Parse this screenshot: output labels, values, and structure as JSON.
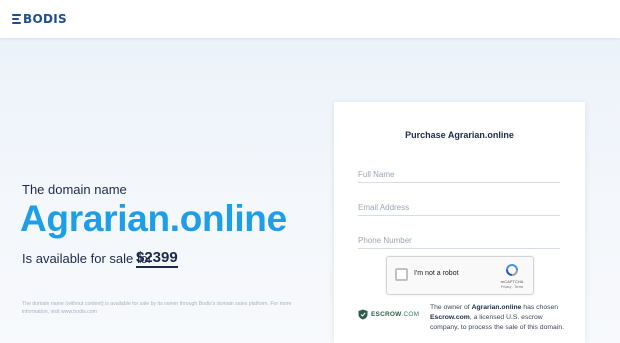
{
  "header": {
    "logo_text": "BODIS"
  },
  "hero": {
    "lead": "The domain name",
    "domain": "Agrarian.online",
    "sale_text": "Is available for sale for",
    "price": "$2399",
    "fineprint": "The domain name (without content) is available for sale by its owner through Bodis's domain sales platform. For more information, visit www.bodis.com"
  },
  "purchase_form": {
    "title": "Purchase Agrarian.online",
    "full_name_placeholder": "Full Name",
    "email_placeholder": "Email Address",
    "phone_placeholder": "Phone Number",
    "captcha": {
      "label": "I'm not a robot",
      "brand": "reCAPTCHA",
      "links": "Privacy - Terms"
    },
    "escrow": {
      "logo_text": "ESCROW",
      "logo_suffix": ".COM",
      "desc_part1": "The owner of ",
      "desc_domain": "Agrarian.online",
      "desc_part2": " has chosen ",
      "desc_escrow": "Escrow.com",
      "desc_part3": ", a licensed U.S. escrow company, to process the sale of this domain."
    }
  },
  "colors": {
    "accent": "#1f9ee8",
    "brand": "#1f4f8b",
    "text": "#1d2b4a",
    "escrow_green": "#2f5d48"
  },
  "icons": {
    "logo": "bodis-logo-icon",
    "captcha": "recaptcha-icon",
    "escrow": "escrow-shield-icon"
  }
}
